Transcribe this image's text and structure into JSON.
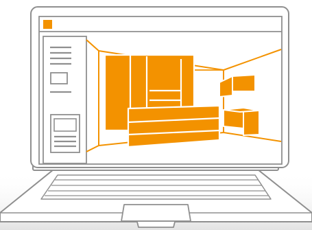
{
  "colors": {
    "outline": "#8f8f8f",
    "accent": "#f39200",
    "paper": "#ffffff",
    "floor": "#e9e9e9"
  },
  "icons": {
    "app": "orange-square-icon",
    "menu": "hamburger-icon",
    "card": "card-icon",
    "device": "laptop-icon"
  }
}
